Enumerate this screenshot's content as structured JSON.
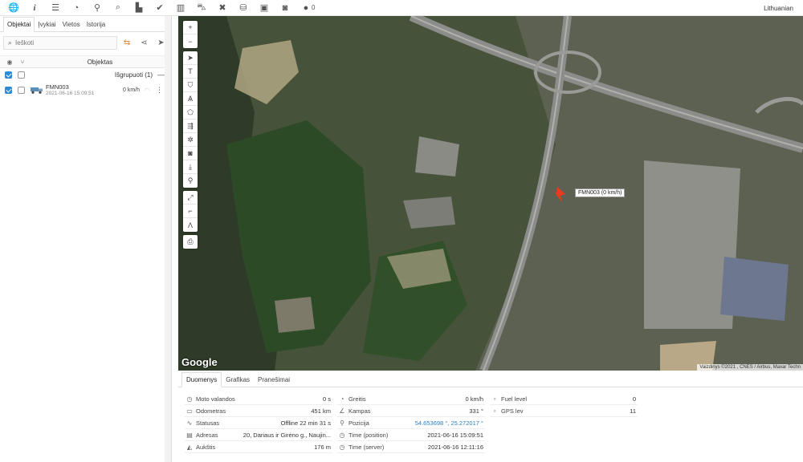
{
  "toolbar": {
    "icons": [
      "globe-icon",
      "info-icon",
      "menu-icon",
      "gauge-icon",
      "pin-icon",
      "search-icon",
      "chart-icon",
      "check-icon",
      "book-icon",
      "car-icon",
      "tools-icon",
      "database-icon",
      "calendar-icon",
      "camera-icon",
      "chat-icon"
    ],
    "chat_count": "0",
    "language": "Lithuanian"
  },
  "left_panel": {
    "tabs": [
      "Objektai",
      "Įvykiai",
      "Vietos",
      "Istorija"
    ],
    "search_placeholder": "Ieškoti",
    "list_header": "Objektas",
    "group_label": "Išgrupuoti (1)",
    "objects": [
      {
        "name": "FMN003",
        "time": "2021-06-16 15:09:51",
        "speed": "0 km/h"
      }
    ]
  },
  "map": {
    "marker_label": "FMN003 (0 km/h)",
    "brand": "Google",
    "attribution": "Vaizdinys ©2021 , CNES / Airbus, Maxar Techn"
  },
  "bottom_panel": {
    "tabs": [
      "Duomenys",
      "Grafikas",
      "Pranešimai"
    ],
    "col1": [
      {
        "icon": "clock-icon",
        "label": "Moto valandos",
        "value": "0 s"
      },
      {
        "icon": "odometer-icon",
        "label": "Odometras",
        "value": "451 km"
      },
      {
        "icon": "status-icon",
        "label": "Statusas",
        "value": "Offline 22 min 31 s"
      },
      {
        "icon": "address-icon",
        "label": "Adresas",
        "value": "20, Dariaus ir Girėno g., Naujin..."
      },
      {
        "icon": "altitude-icon",
        "label": "Aukštis",
        "value": "176 m"
      }
    ],
    "col2": [
      {
        "icon": "speed-icon",
        "label": "Greitis",
        "value": "0 km/h"
      },
      {
        "icon": "angle-icon",
        "label": "Kampas",
        "value": "331 °"
      },
      {
        "icon": "position-icon",
        "label": "Pozicija",
        "value": "54.653698 °, 25.272017 °"
      },
      {
        "icon": "time-icon",
        "label": "Time (position)",
        "value": "2021-06-16 15:09:51"
      },
      {
        "icon": "time-server-icon",
        "label": "Time (server)",
        "value": "2021-06-16 12:11:16"
      }
    ],
    "col3": [
      {
        "icon": "fuel-icon",
        "label": "Fuel level",
        "value": "0"
      },
      {
        "icon": "gps-icon",
        "label": "GPS lev",
        "value": "11"
      }
    ]
  }
}
